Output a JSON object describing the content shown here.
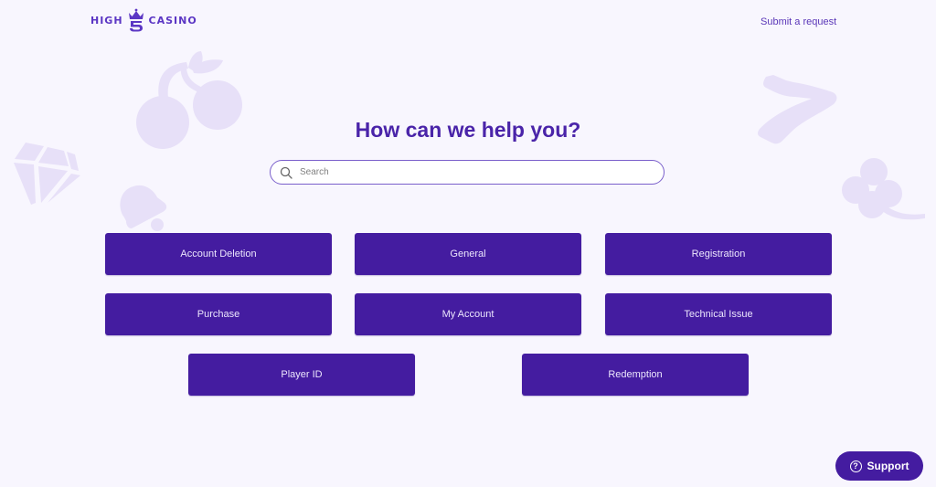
{
  "header": {
    "logo_left": "HIGH",
    "logo_right": "CASINO",
    "submit_request": "Submit a request"
  },
  "hero": {
    "title": "How can we help you?",
    "search_placeholder": "Search",
    "search_value": ""
  },
  "categories": [
    {
      "label": "Account Deletion"
    },
    {
      "label": "General"
    },
    {
      "label": "Registration"
    },
    {
      "label": "Purchase"
    },
    {
      "label": "My Account"
    },
    {
      "label": "Technical Issue"
    },
    {
      "label": "Player ID"
    },
    {
      "label": "Redemption"
    }
  ],
  "support": {
    "label": "Support",
    "icon_glyph": "?"
  },
  "decorations": [
    "cherry-icon",
    "diamond-icon",
    "bell-icon",
    "seven-icon",
    "club-icon"
  ],
  "colors": {
    "background": "#f8f6fe",
    "brand": "#441ca0",
    "heading": "#4a24a9",
    "decoration": "#e7e0f8"
  }
}
